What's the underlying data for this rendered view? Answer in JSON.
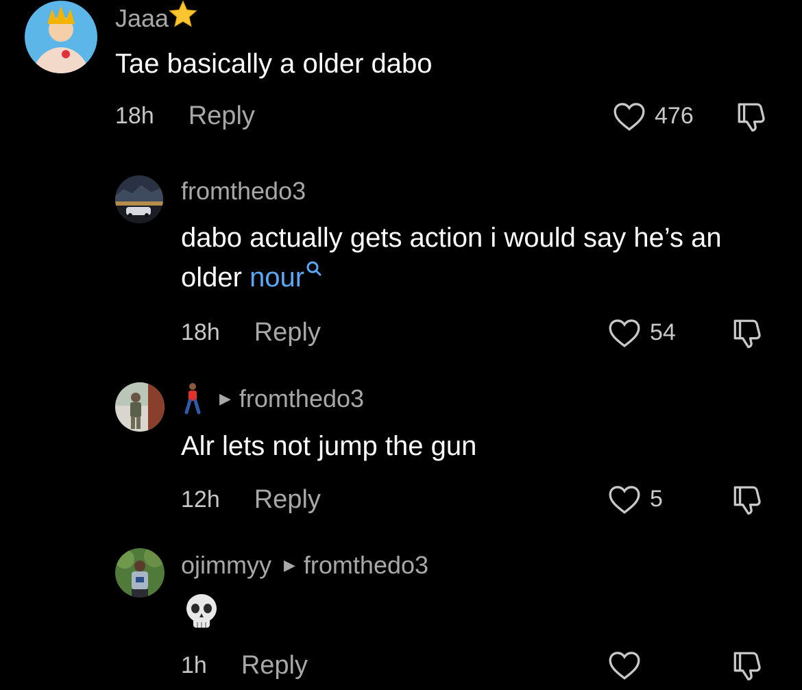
{
  "comments": [
    {
      "username": "Jaaa",
      "text": "Tae basically a older dabo",
      "time": "18h",
      "reply_label": "Reply",
      "likes": "476"
    },
    {
      "username": "fromthedo3",
      "text_prefix": "dabo actually gets action i would say he’s an older ",
      "mention": "nour",
      "time": "18h",
      "reply_label": "Reply",
      "likes": "54"
    },
    {
      "username": "",
      "reply_to": "fromthedo3",
      "text": "Alr lets not jump the gun",
      "time": "12h",
      "reply_label": "Reply",
      "likes": "5"
    },
    {
      "username": "ojimmyy",
      "reply_to": "fromthedo3",
      "text": "💀",
      "time": "1h",
      "reply_label": "Reply",
      "likes": ""
    }
  ],
  "icons": {
    "like": "heart-outline-icon",
    "dislike": "thumbs-down-icon",
    "reply_arrow": "triangle-right-icon",
    "search": "search-icon"
  },
  "colors": {
    "background": "#000000",
    "username": "#a8a8a8",
    "text": "#ffffff",
    "mention": "#5aa9f6"
  }
}
